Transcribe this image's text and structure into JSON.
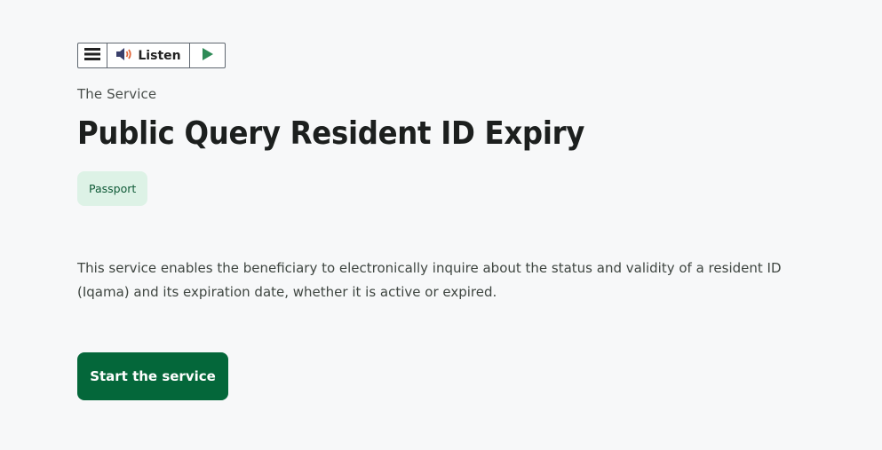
{
  "toolbar": {
    "menu_icon": "hamburger-icon",
    "speaker_icon": "speaker-icon",
    "listen_label": "Listen",
    "play_icon": "play-icon"
  },
  "header": {
    "section_label": "The Service",
    "title": "Public Query Resident ID Expiry"
  },
  "tags": [
    "Passport"
  ],
  "main": {
    "description": "This service enables the beneficiary to electronically inquire about the status and validity of a resident ID (Iqama) and its expiration date, whether it is active or expired.",
    "start_label": "Start the service"
  },
  "colors": {
    "primary": "#04673a",
    "tag_bg": "#ddf2e6",
    "tag_text": "#0f5a37",
    "background": "#f7f8f9",
    "play_icon": "#2e8b57",
    "speaker_icon": "#3a3f6b"
  }
}
